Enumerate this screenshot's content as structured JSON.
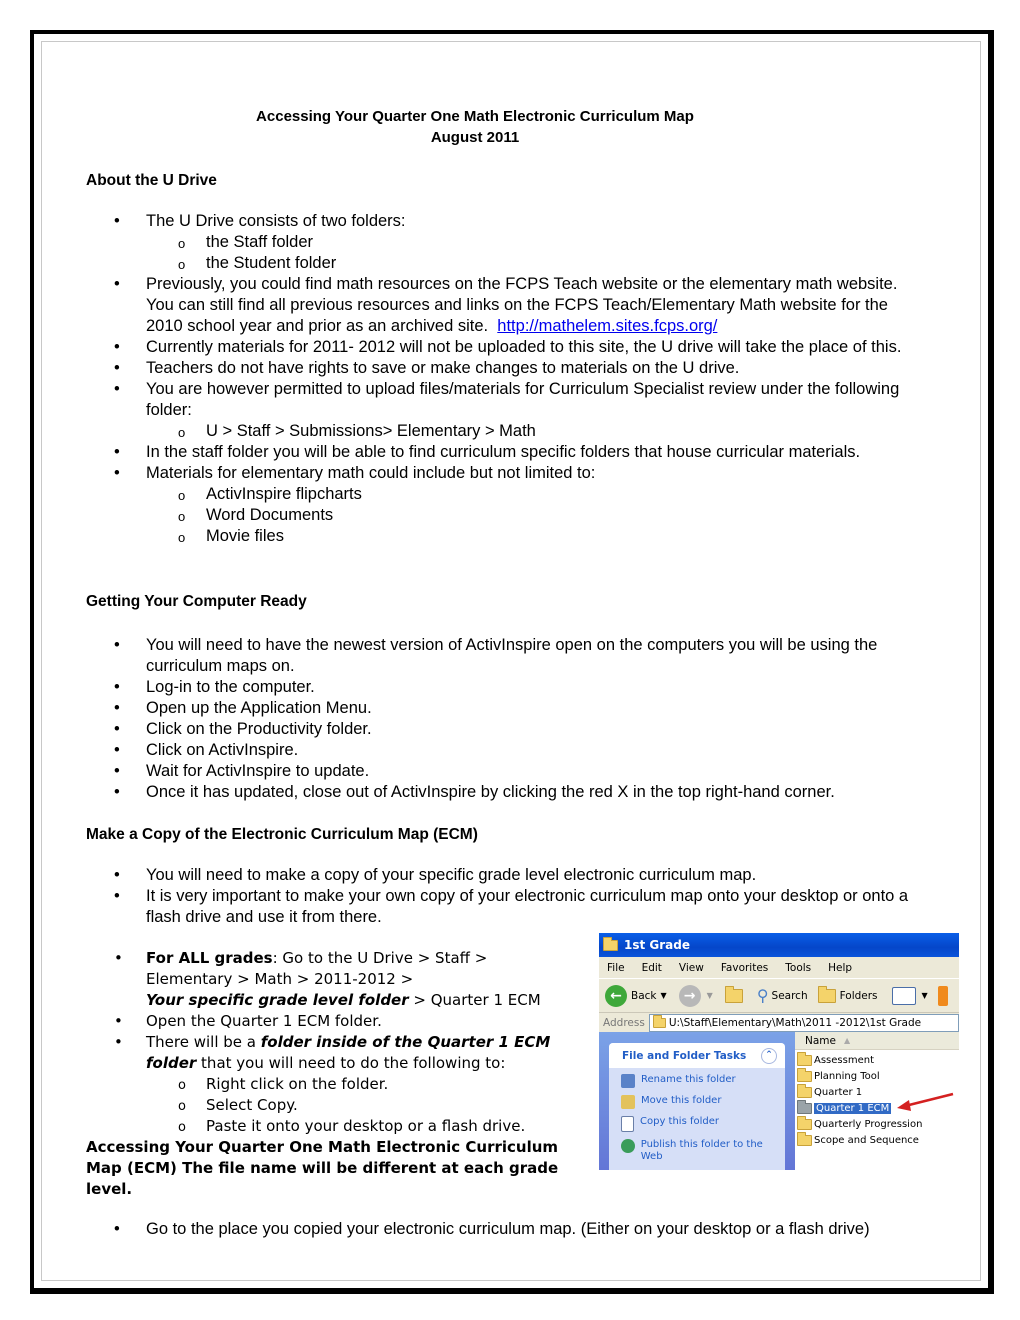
{
  "document": {
    "title_line1": "Accessing Your Quarter One Math Electronic Curriculum Map",
    "title_line2": "August 2011",
    "sections": {
      "udrive": {
        "heading": "About the U Drive",
        "b1": "The U Drive consists of two folders:",
        "b1_sub": [
          "the Staff folder",
          "the Student folder"
        ],
        "b2": "Previously, you could find math resources on the FCPS Teach website or the elementary math website. You can still find all previous resources and links on the FCPS Teach/Elementary Math website for the 2010 school year and prior as an archived site.",
        "b2_link": "http://mathelem.sites.fcps.org/",
        "b3": "Currently materials for 2011- 2012 will not be uploaded to this site, the U drive will take the place of this.",
        "b4": "Teachers do not have rights to save or make changes to materials on the U drive.",
        "b5": "You are however permitted to upload files/materials for Curriculum Specialist review under the following folder:",
        "b5_sub": [
          "U > Staff > Submissions> Elementary > Math"
        ],
        "b6": "In the staff folder you will be able to find curriculum specific folders that house curricular materials.",
        "b7": "Materials for elementary math could include but not limited to:",
        "b7_sub": [
          "ActivInspire flipcharts",
          "Word Documents",
          "Movie files"
        ]
      },
      "computer": {
        "heading": "Getting Your Computer Ready",
        "items": [
          "You will need to have the newest version of ActivInspire open on the computers you will be using the curriculum maps on.",
          "Log-in to the computer.",
          "Open up the Application Menu.",
          "Click on the Productivity folder.",
          "Click on ActivInspire.",
          "Wait for ActivInspire to update.",
          "Once it has updated, close out of ActivInspire by clicking the red X in the top right-hand corner."
        ]
      },
      "copy": {
        "heading": "Make a Copy of the Electronic Curriculum Map (ECM)",
        "items": [
          "You will need to make a copy of your specific grade level electronic curriculum map.",
          "It is very important to make your own copy of your electronic curriculum map onto your desktop or onto a flash drive and use it from there."
        ],
        "all_grades_bold": "For ALL grades",
        "all_grades_text": ":   Go to the U Drive > Staff > Elementary > Math > 2011-2012 >",
        "all_grades_italic": "Your specific grade level folder",
        "all_grades_tail": " > Quarter 1 ECM",
        "open_folder": "Open the Quarter 1 ECM folder.",
        "there_will_be": "There will be a ",
        "folder_inside_bi": "folder inside of the Quarter 1 ECM folder",
        "there_tail": " that you will  need to do the following to:",
        "steps": [
          "Right click on the folder.",
          "Select Copy.",
          "Paste it onto your desktop or a flash drive."
        ]
      },
      "accessing": {
        "heading": "Accessing Your Quarter One Math Electronic Curriculum Map (ECM) The file name will be different at each grade level.",
        "items": [
          "Go to the place you copied your electronic curriculum map. (Either on your desktop or a flash drive)"
        ]
      }
    }
  },
  "explorer": {
    "window_title": "1st Grade",
    "menu": [
      "File",
      "Edit",
      "View",
      "Favorites",
      "Tools",
      "Help"
    ],
    "toolbar": {
      "back": "Back",
      "search": "Search",
      "folders": "Folders"
    },
    "address_label": "Address",
    "address_value": "U:\\Staff\\Elementary\\Math\\2011 -2012\\1st Grade",
    "tasks_title": "File and Folder Tasks",
    "tasks": [
      "Rename this folder",
      "Move this folder",
      "Copy this folder",
      "Publish this folder to the Web"
    ],
    "column_header": "Name",
    "files": [
      "Assessment",
      "Planning Tool",
      "Quarter 1",
      "Quarter 1 ECM",
      "Quarterly Progression",
      "Scope and Sequence"
    ],
    "selected_file": "Quarter 1 ECM",
    "colors": {
      "title_bar": "#0a54da",
      "selection": "#316ac5",
      "arrow": "#d42020",
      "task_text": "#215dc6"
    }
  }
}
